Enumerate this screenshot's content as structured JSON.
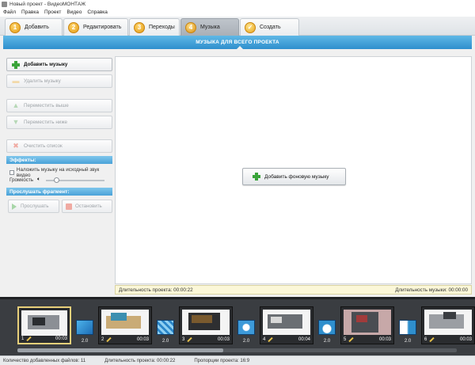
{
  "window": {
    "title": "Новый проект - ВидеоМОНТАЖ"
  },
  "menu": [
    "Файл",
    "Правка",
    "Проект",
    "Видео",
    "Справка"
  ],
  "tabs": [
    {
      "num": "1",
      "label": "Добавить"
    },
    {
      "num": "2",
      "label": "Редактировать"
    },
    {
      "num": "3",
      "label": "Переходы"
    },
    {
      "num": "4",
      "label": "Музыка",
      "active": true
    },
    {
      "num": "5",
      "label": "Создать"
    }
  ],
  "header": {
    "title": "МУЗЫКА ДЛЯ ВСЕГО ПРОЕКТА"
  },
  "sidebar": {
    "add_music": "Добавить музыку",
    "remove_music": "Удалить музыку",
    "move_up": "Переместить выше",
    "move_down": "Переместить ниже",
    "clear_list": "Очистить список",
    "effects_title": "Эффекты:",
    "overlay_label": "Наложить музыку на исходный звук видео",
    "volume_label": "Громкость",
    "preview_title": "Прослушать фрагмент:",
    "listen": "Прослушать",
    "stop": "Остановить"
  },
  "main": {
    "add_background_music": "Добавить фоновую музыку"
  },
  "durations": {
    "project_label": "Длительность проекта: 00:00:22",
    "music_label": "Длительность музыки: 00:00:00"
  },
  "timeline": {
    "clips": [
      {
        "index": "1",
        "duration": "00:03"
      },
      {
        "index": "2",
        "duration": "00:03"
      },
      {
        "index": "3",
        "duration": "00:03"
      },
      {
        "index": "4",
        "duration": "00:04"
      },
      {
        "index": "5",
        "duration": "00:03"
      },
      {
        "index": "6",
        "duration": "00:03"
      }
    ],
    "transitions": [
      "2.0",
      "2.0",
      "2.0",
      "2.0",
      "2.0"
    ]
  },
  "status": {
    "files_added": "Количество добавленных файлов: 11",
    "project_duration": "Длительность проекта: 00:00:22",
    "aspect": "Пропорции проекта: 16:9"
  },
  "colors": {
    "accent_blue": "#2f8fcd",
    "step_orange": "#e39b16",
    "timeline_bg": "#3a3d41",
    "selected_clip": "#e8d07a"
  }
}
